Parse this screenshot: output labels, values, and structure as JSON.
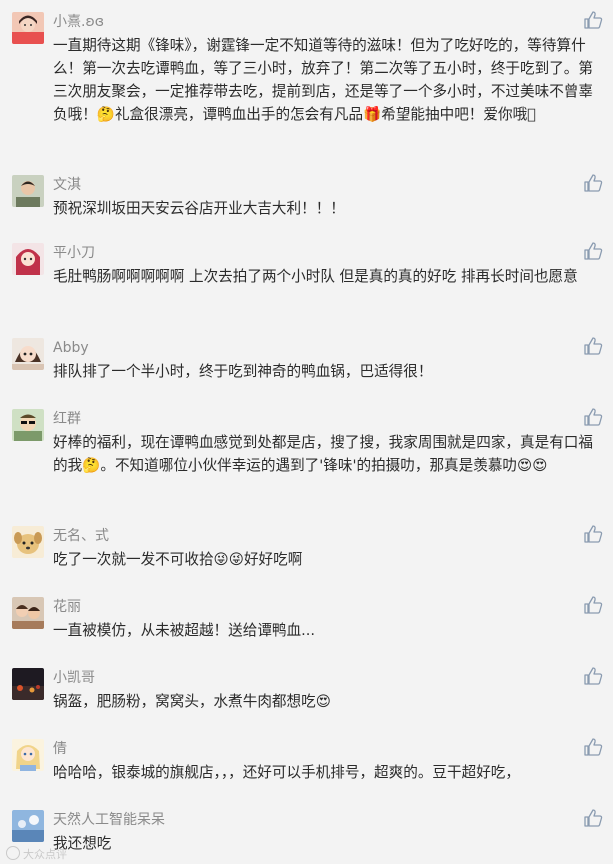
{
  "comments": [
    {
      "username": "小熹.ʚɞ",
      "text": "一直期待这期《锋味》，谢霆锋一定不知道等待的滋味！但为了吃好吃的，等待算什么！第一次去吃谭鸭血，等了三小时，放弃了！第二次等了五小时，终于吃到了。第三次朋友聚会，一定推荐带去吃，提前到店，还是等了一个多小时，不过美味不曾辜负哦！🤔礼盒很漂亮，谭鸭血出手的怎会有凡品🎁希望能抽中吧！爱你哦􀀀",
      "avatar_icon": "avatar-girl-red-icon",
      "avatar_color": "#e8504f"
    },
    {
      "username": "文淇",
      "text": "预祝深圳坂田天安云谷店开业大吉大利！！！",
      "avatar_icon": "avatar-man-icon",
      "avatar_color": "#9aa58c"
    },
    {
      "username": "平小刀",
      "text": "毛肚鸭肠啊啊啊啊啊 上次去拍了两个小时队 但是真的真的好吃 排再长时间也愿意",
      "avatar_icon": "avatar-anime-icon",
      "avatar_color": "#c0324a"
    },
    {
      "username": "Abby",
      "text": "排队排了一个半小时，终于吃到神奇的鸭血锅，巴适得很！",
      "avatar_icon": "avatar-cartoon-girl-icon",
      "avatar_color": "#d9c4b3"
    },
    {
      "username": "红群",
      "text": "好棒的福利，现在谭鸭血感觉到处都是店，搜了搜，我家周围就是四家，真是有口福的我🤔。不知道哪位小伙伴幸运的遇到了'锋味'的拍摄叻，那真是羡慕叻😍😍",
      "avatar_icon": "avatar-sunglasses-icon",
      "avatar_color": "#7c9a6a"
    },
    {
      "username": "无名、式",
      "text": "吃了一次就一发不可收拾😜😜好好吃啊",
      "avatar_icon": "avatar-puppy-icon",
      "avatar_color": "#e7c27d"
    },
    {
      "username": "花丽",
      "text": "一直被模仿，从未被超越！送给谭鸭血...",
      "avatar_icon": "avatar-kids-icon",
      "avatar_color": "#a67b5b"
    },
    {
      "username": "小凯哥",
      "text": "锅盔，肥肠粉，窝窝头，水煮牛肉都想吃😍",
      "avatar_icon": "avatar-night-icon",
      "avatar_color": "#3a2a2a"
    },
    {
      "username": "倩",
      "text": "哈哈哈，银泰城的旗舰店，，，还好可以手机排号，超爽的。豆干超好吃，",
      "avatar_icon": "avatar-blonde-cartoon-icon",
      "avatar_color": "#f1d48a"
    },
    {
      "username": "天然人工智能呆呆",
      "text": "我还想吃",
      "avatar_icon": "avatar-sky-icon",
      "avatar_color": "#5a86b8"
    }
  ],
  "like_icon": "thumbs-up-icon",
  "like_color": "#8a9bb0",
  "watermark": "大众点评"
}
